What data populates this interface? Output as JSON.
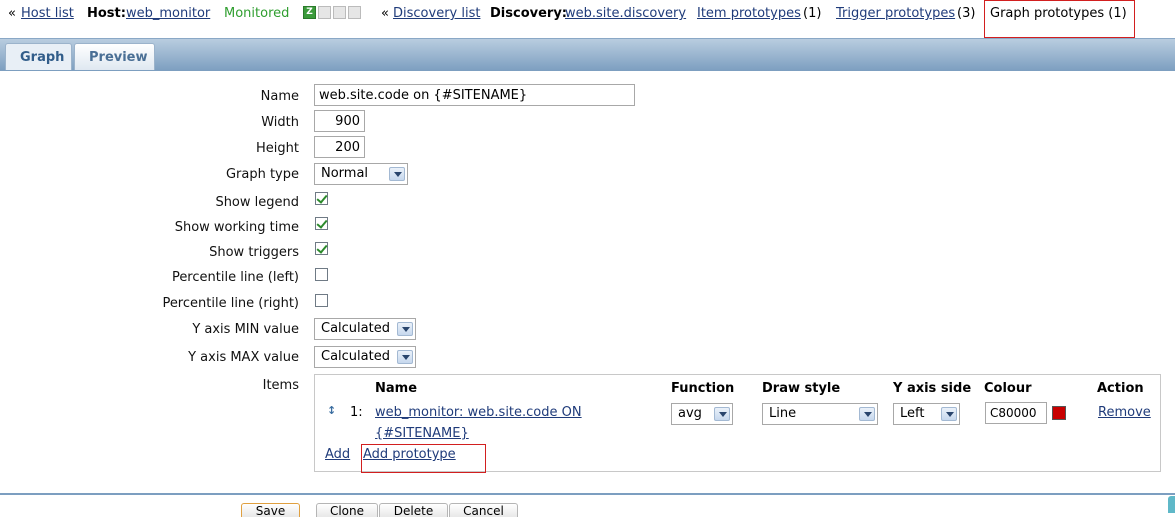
{
  "breadcrumbs": {
    "host_list_prefix": "«",
    "host_list": "Host list",
    "host_label": "Host:",
    "host_name": "web_monitor",
    "host_status": "Monitored",
    "status_icons": [
      "Z",
      "",
      "",
      ""
    ],
    "discovery_list_prefix": "«",
    "discovery_list": "Discovery list",
    "discovery_label": "Discovery:",
    "discovery_name": "web.site.discovery",
    "item_prototypes": "Item prototypes",
    "item_prototypes_count": "(1)",
    "trigger_prototypes": "Trigger prototypes",
    "trigger_prototypes_count": "(3)",
    "graph_prototypes": "Graph prototypes (1)"
  },
  "tabs": [
    {
      "label": "Graph",
      "active": true
    },
    {
      "label": "Preview",
      "active": false
    }
  ],
  "form": {
    "name_label": "Name",
    "name_value": "web.site.code on {#SITENAME}",
    "width_label": "Width",
    "width_value": "900",
    "height_label": "Height",
    "height_value": "200",
    "graph_type_label": "Graph type",
    "graph_type_value": "Normal",
    "show_legend_label": "Show legend",
    "show_legend": true,
    "show_working_time_label": "Show working time",
    "show_working_time": true,
    "show_triggers_label": "Show triggers",
    "show_triggers": true,
    "percentile_left_label": "Percentile line (left)",
    "percentile_left": false,
    "percentile_right_label": "Percentile line (right)",
    "percentile_right": false,
    "ymin_label": "Y axis MIN value",
    "ymin_value": "Calculated",
    "ymax_label": "Y axis MAX value",
    "ymax_value": "Calculated",
    "items_label": "Items"
  },
  "items_table": {
    "headers": {
      "name": "Name",
      "function": "Function",
      "draw_style": "Draw style",
      "y_axis_side": "Y axis side",
      "colour": "Colour",
      "action": "Action"
    },
    "rows": [
      {
        "index": "1:",
        "name_line1": "web_monitor: web.site.code ON",
        "name_line2": "{#SITENAME}",
        "function": "avg",
        "draw_style": "Line",
        "y_axis_side": "Left",
        "colour": "C80000",
        "colour_hex": "#C80000",
        "action": "Remove"
      }
    ],
    "add_link": "Add",
    "add_prototype_link": "Add prototype"
  },
  "buttons": {
    "save": "Save",
    "clone": "Clone",
    "delete": "Delete",
    "cancel": "Cancel"
  },
  "colors": {
    "link": "#1f3b7a",
    "monitored": "#2f9e2f",
    "highlight_box": "#d21f1f",
    "tab_bar": "#7c9ec0"
  }
}
